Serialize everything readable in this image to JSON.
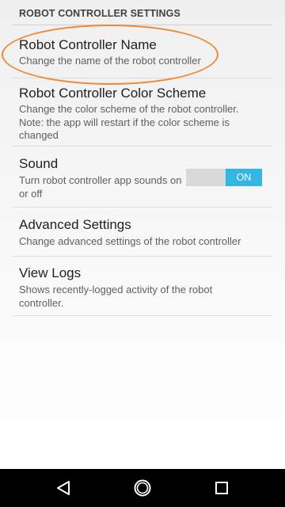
{
  "header": {
    "title": "ROBOT CONTROLLER SETTINGS"
  },
  "preferences": [
    {
      "title": "Robot Controller Name",
      "summary": "Change the name of the robot controller"
    },
    {
      "title": "Robot Controller Color Scheme",
      "summary": "Change the color scheme of the robot controller. Note: the app will restart if the color scheme is changed"
    },
    {
      "title": "Sound",
      "summary": "Turn robot controller app sounds on or off",
      "toggle_label": "ON",
      "toggle_on": true
    },
    {
      "title": "Advanced Settings",
      "summary": "Change advanced settings of the robot controller"
    },
    {
      "title": "View Logs",
      "summary": "Shows recently-logged activity of the robot controller."
    }
  ],
  "annotation": {
    "highlighted_item": "Robot Controller Name",
    "color": "#ee8a36"
  },
  "colors": {
    "accent": "#33b5e5",
    "toggle_track": "#d9d9d9",
    "navbar": "#000000"
  },
  "navbar": {
    "buttons": [
      "back-icon",
      "home-icon",
      "recents-icon"
    ]
  }
}
